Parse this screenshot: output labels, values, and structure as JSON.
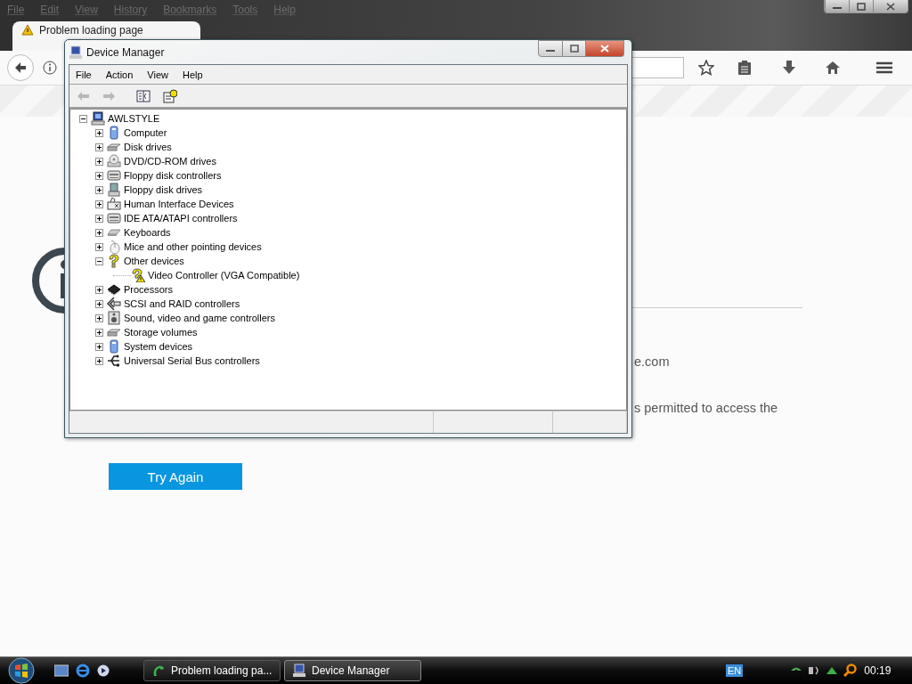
{
  "browser": {
    "menu": [
      "File",
      "Edit",
      "View",
      "History",
      "Bookmarks",
      "Tools",
      "Help"
    ],
    "tab": {
      "title": "Problem loading page",
      "selected": true
    },
    "page": {
      "lines": [
        "e.com",
        "s permitted to access the"
      ],
      "button": "Try Again"
    }
  },
  "device_manager": {
    "title": "Device Manager",
    "menu": [
      "File",
      "Action",
      "View",
      "Help"
    ],
    "toolbar": [
      {
        "kind": "back",
        "disabled": true
      },
      {
        "kind": "forward",
        "disabled": true
      },
      {
        "kind": "panel",
        "disabled": false
      },
      {
        "kind": "help",
        "disabled": false
      }
    ],
    "tree": {
      "label": "AWLSTYLE",
      "kind": "computer",
      "expanded": true,
      "children": [
        {
          "label": "Computer",
          "kind": "system",
          "expanded": false
        },
        {
          "label": "Disk drives",
          "kind": "disk",
          "expanded": false
        },
        {
          "label": "DVD/CD-ROM drives",
          "kind": "dvd",
          "expanded": false
        },
        {
          "label": "Floppy disk controllers",
          "kind": "controller",
          "expanded": false
        },
        {
          "label": "Floppy disk drives",
          "kind": "floppy",
          "expanded": false
        },
        {
          "label": "Human Interface Devices",
          "kind": "hid",
          "expanded": false
        },
        {
          "label": "IDE ATA/ATAPI controllers",
          "kind": "controller",
          "expanded": false
        },
        {
          "label": "Keyboards",
          "kind": "keyboard",
          "expanded": false
        },
        {
          "label": "Mice and other pointing devices",
          "kind": "mouse",
          "expanded": false
        },
        {
          "label": "Other devices",
          "kind": "unknown",
          "expanded": true,
          "children": [
            {
              "label": "Video Controller (VGA Compatible)",
              "kind": "warning"
            }
          ]
        },
        {
          "label": "Processors",
          "kind": "chip",
          "expanded": false
        },
        {
          "label": "SCSI and RAID controllers",
          "kind": "scsi",
          "expanded": false
        },
        {
          "label": "Sound, video and game controllers",
          "kind": "sound",
          "expanded": false
        },
        {
          "label": "Storage volumes",
          "kind": "disk",
          "expanded": false
        },
        {
          "label": "System devices",
          "kind": "system",
          "expanded": false
        },
        {
          "label": "Universal Serial Bus controllers",
          "kind": "usb",
          "expanded": false
        }
      ]
    }
  },
  "taskbar": {
    "tasks": [
      {
        "label": "Problem loading pa...",
        "kind": "browser",
        "selected": false
      },
      {
        "label": "Device Manager",
        "kind": "computer",
        "selected": true
      }
    ],
    "language": "EN",
    "clock": "00:19"
  }
}
